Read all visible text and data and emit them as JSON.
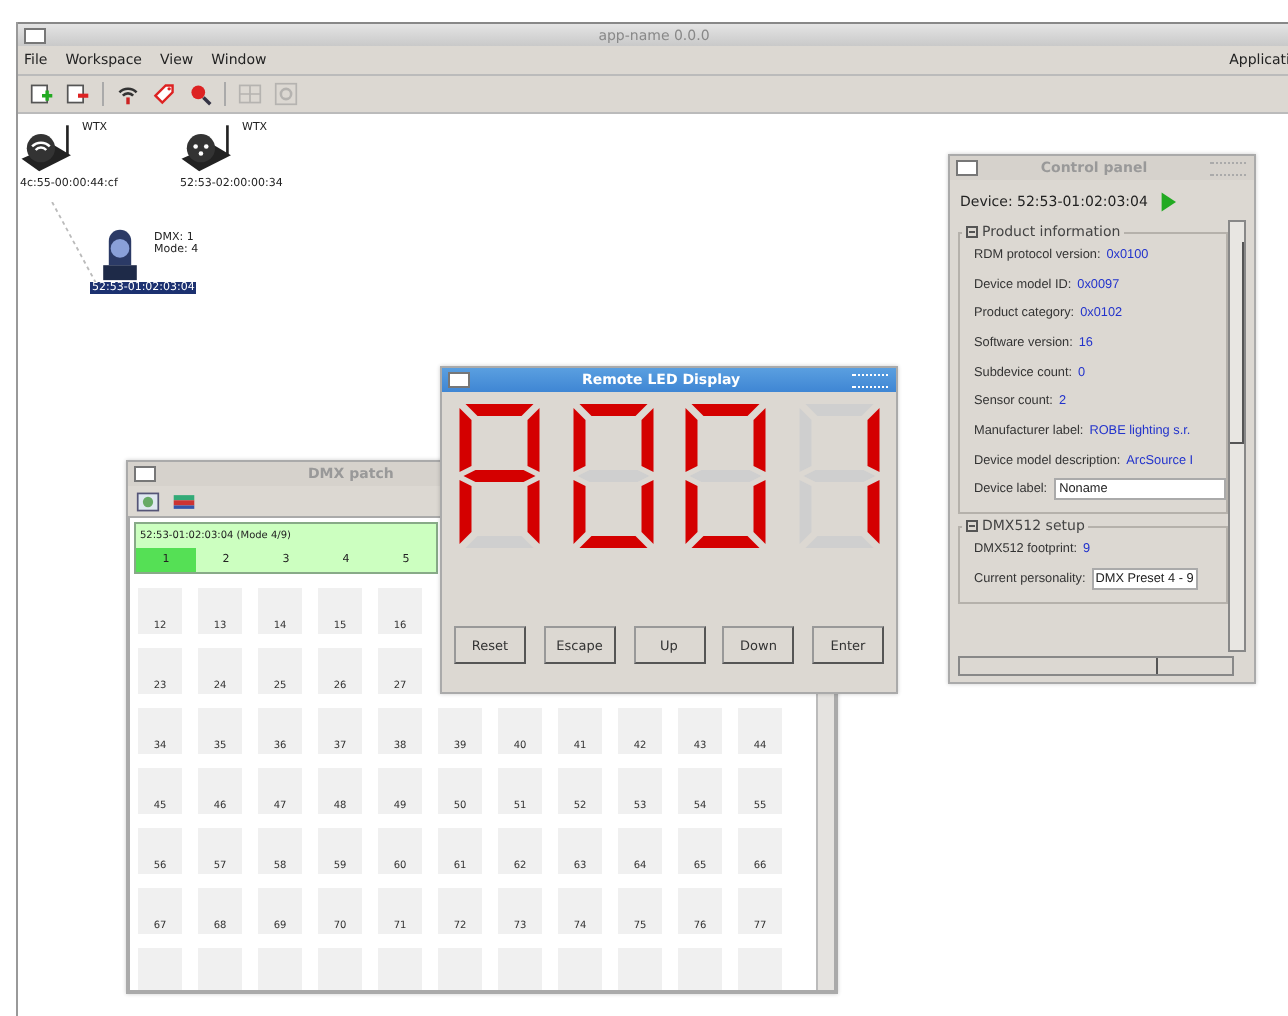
{
  "main_window": {
    "title": "app-name 0.0.0",
    "menu": [
      "File",
      "Workspace",
      "View",
      "Window"
    ],
    "menu_right": "Applicati"
  },
  "toolbar": [
    {
      "kind": "add",
      "disabled": false
    },
    {
      "kind": "remove",
      "disabled": false
    },
    {
      "kind": "wifi",
      "disabled": false
    },
    {
      "kind": "tag",
      "disabled": false
    },
    {
      "kind": "probe",
      "disabled": false
    },
    {
      "kind": "grid",
      "disabled": true
    },
    {
      "kind": "gear",
      "disabled": true
    }
  ],
  "canvas": {
    "nodes": [
      {
        "kind": "wifi-transmitter",
        "tag": "WTX",
        "address": "4c:55-00:00:44:cf",
        "selected": false
      },
      {
        "kind": "dmx-transmitter",
        "tag": "WTX",
        "address": "52:53-02:00:00:34",
        "selected": false
      },
      {
        "kind": "moving-head",
        "lines": [
          "DMX: 1",
          "Mode: 4"
        ],
        "address": "52:53-01:02:03:04",
        "selected": true
      }
    ]
  },
  "control_panel": {
    "title": "Control panel",
    "device": "Device: 52:53-01:02:03:04",
    "groups": [
      {
        "title": "Product information",
        "rows": [
          {
            "kind": "value",
            "label": "RDM protocol version:",
            "value": "0x0100"
          },
          {
            "kind": "value",
            "label": "Device model ID:",
            "value": "0x0097"
          },
          {
            "kind": "value",
            "label": "Product category:",
            "value": "0x0102"
          },
          {
            "kind": "value",
            "label": "Software version:",
            "value": "16"
          },
          {
            "kind": "value",
            "label": "Subdevice count:",
            "value": "0"
          },
          {
            "kind": "value",
            "label": "Sensor count:",
            "value": "2"
          },
          {
            "kind": "value",
            "label": "Manufacturer label:",
            "value": "ROBE lighting s.r."
          },
          {
            "kind": "value",
            "label": "Device model description:",
            "value": "ArcSource I"
          },
          {
            "kind": "field",
            "label": "Device label:",
            "value": "Noname"
          }
        ]
      },
      {
        "title": "DMX512 setup",
        "rows": [
          {
            "kind": "value",
            "label": "DMX512 footprint:",
            "value": "9"
          },
          {
            "kind": "select",
            "label": "Current personality:",
            "value": "DMX Preset 4 - 9"
          }
        ]
      }
    ]
  },
  "dmx_patch": {
    "title": "DMX patch",
    "fixture": "52:53-01:02:03:04 (Mode 4/9)",
    "channels": [
      {
        "label": "1",
        "selected": true
      },
      {
        "label": "2",
        "selected": false
      },
      {
        "label": "3",
        "selected": false
      },
      {
        "label": "4",
        "selected": false
      },
      {
        "label": "5",
        "selected": false
      }
    ],
    "rows": [
      [
        "12",
        "13",
        "14",
        "15",
        "16"
      ],
      [
        "23",
        "24",
        "25",
        "26",
        "27"
      ],
      [
        "34",
        "35",
        "36",
        "37",
        "38",
        "39",
        "40",
        "41",
        "42",
        "43",
        "44"
      ],
      [
        "45",
        "46",
        "47",
        "48",
        "49",
        "50",
        "51",
        "52",
        "53",
        "54",
        "55"
      ],
      [
        "56",
        "57",
        "58",
        "59",
        "60",
        "61",
        "62",
        "63",
        "64",
        "65",
        "66"
      ],
      [
        "67",
        "68",
        "69",
        "70",
        "71",
        "72",
        "73",
        "74",
        "75",
        "76",
        "77"
      ]
    ]
  },
  "led_display": {
    "title": "Remote LED Display",
    "digits": [
      {
        "segments": [
          true,
          true,
          true,
          false,
          true,
          true,
          true
        ]
      },
      {
        "segments": [
          true,
          true,
          true,
          true,
          true,
          true,
          false
        ]
      },
      {
        "segments": [
          true,
          true,
          true,
          true,
          true,
          true,
          false
        ]
      },
      {
        "segments": [
          false,
          true,
          true,
          false,
          false,
          false,
          false
        ]
      }
    ],
    "buttons": [
      "Reset",
      "Escape",
      "Up",
      "Down",
      "Enter"
    ]
  }
}
